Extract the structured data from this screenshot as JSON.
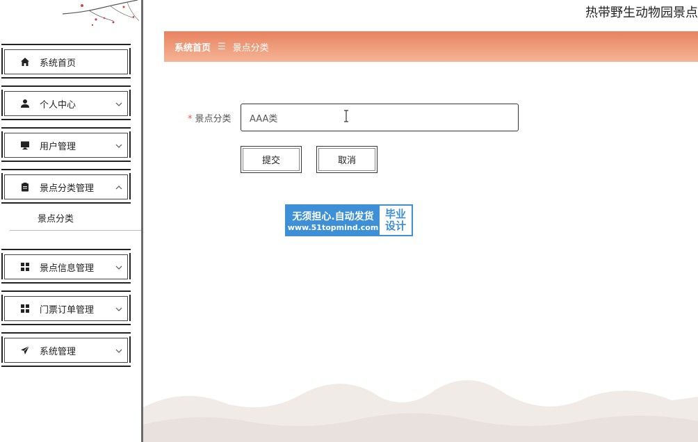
{
  "header": {
    "site_title": "热带野生动物园景点"
  },
  "sidebar": {
    "items": [
      {
        "label": "系统首页",
        "icon": "home-icon",
        "expandable": false
      },
      {
        "label": "个人中心",
        "icon": "user-icon",
        "expandable": true,
        "expanded": false
      },
      {
        "label": "用户管理",
        "icon": "monitor-icon",
        "expandable": true,
        "expanded": false
      },
      {
        "label": "景点分类管理",
        "icon": "clipboard-icon",
        "expandable": true,
        "expanded": true
      },
      {
        "label": "景点信息管理",
        "icon": "grid-icon",
        "expandable": true,
        "expanded": false
      },
      {
        "label": "门票订单管理",
        "icon": "grid-icon",
        "expandable": true,
        "expanded": false
      },
      {
        "label": "系统管理",
        "icon": "send-icon",
        "expandable": true,
        "expanded": false
      }
    ],
    "submenu": {
      "label": "景点分类"
    }
  },
  "breadcrumb": {
    "home": "系统首页",
    "separator": "☰",
    "current": "景点分类"
  },
  "form": {
    "required_mark": "*",
    "label": "景点分类",
    "value": "AAA类",
    "submit_label": "提交",
    "cancel_label": "取消"
  },
  "watermark": {
    "line1": "无须担心.自动发货",
    "line2": "www.51topmind.com",
    "badge_line1": "毕业",
    "badge_line2": "设计"
  },
  "colors": {
    "breadcrumb_top": "#e8825f",
    "breadcrumb_bottom": "#f5b596",
    "watermark_blue": "#3d8fd6",
    "required": "#e55555"
  }
}
